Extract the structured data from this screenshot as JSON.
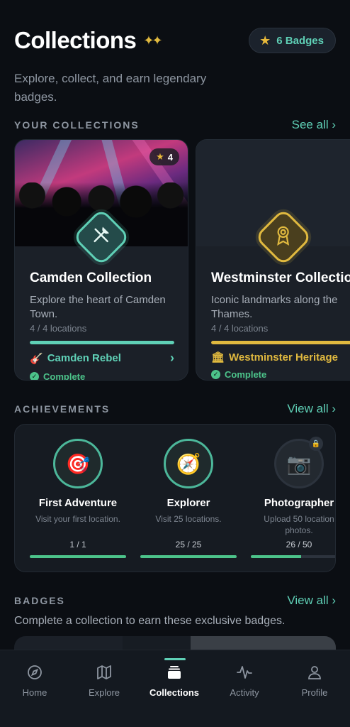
{
  "header": {
    "title": "Collections",
    "sparkle": "✦✦",
    "badge_count_label": "6 Badges",
    "subtitle": "Explore, collect, and earn legendary badges."
  },
  "collections_section": {
    "title": "YOUR COLLECTIONS",
    "link": "See all ›",
    "cards": [
      {
        "rating": "4",
        "name": "Camden Collection",
        "description": "Explore the heart of Camden Town.",
        "count": "4 / 4 locations",
        "progress": 1.0,
        "reward_icon": "🎸",
        "reward_name": "Camden Rebel",
        "status": "Complete",
        "accent": "#5fd0b6"
      },
      {
        "name": "Westminster Collection",
        "description": "Iconic landmarks along the Thames.",
        "count": "4 / 4 locations",
        "progress": 1.0,
        "reward_icon": "🏛",
        "reward_name": "Westminster Heritage",
        "status": "Complete",
        "accent": "#e0b93f"
      }
    ]
  },
  "achievements_section": {
    "title": "ACHIEVEMENTS",
    "link": "View all ›",
    "items": [
      {
        "name": "First Adventure",
        "description": "Visit your first location.",
        "progress_text": "1 / 1",
        "progress": 1.0,
        "icon": "🎯",
        "locked": false
      },
      {
        "name": "Explorer",
        "description": "Visit 25 locations.",
        "progress_text": "25 / 25",
        "progress": 1.0,
        "icon": "🧭",
        "locked": false
      },
      {
        "name": "Photographer",
        "description": "Upload 50 location photos.",
        "progress_text": "26 / 50",
        "progress": 0.52,
        "icon": "📷",
        "locked": true
      }
    ]
  },
  "badges_section": {
    "title": "BADGES",
    "link": "View all ›",
    "description": "Complete a collection to earn these exclusive badges."
  },
  "nav": {
    "items": [
      {
        "label": "Home",
        "icon": "compass-icon"
      },
      {
        "label": "Explore",
        "icon": "map-icon"
      },
      {
        "label": "Collections",
        "icon": "collections-icon",
        "active": true
      },
      {
        "label": "Activity",
        "icon": "activity-icon"
      },
      {
        "label": "Profile",
        "icon": "profile-icon"
      }
    ]
  }
}
